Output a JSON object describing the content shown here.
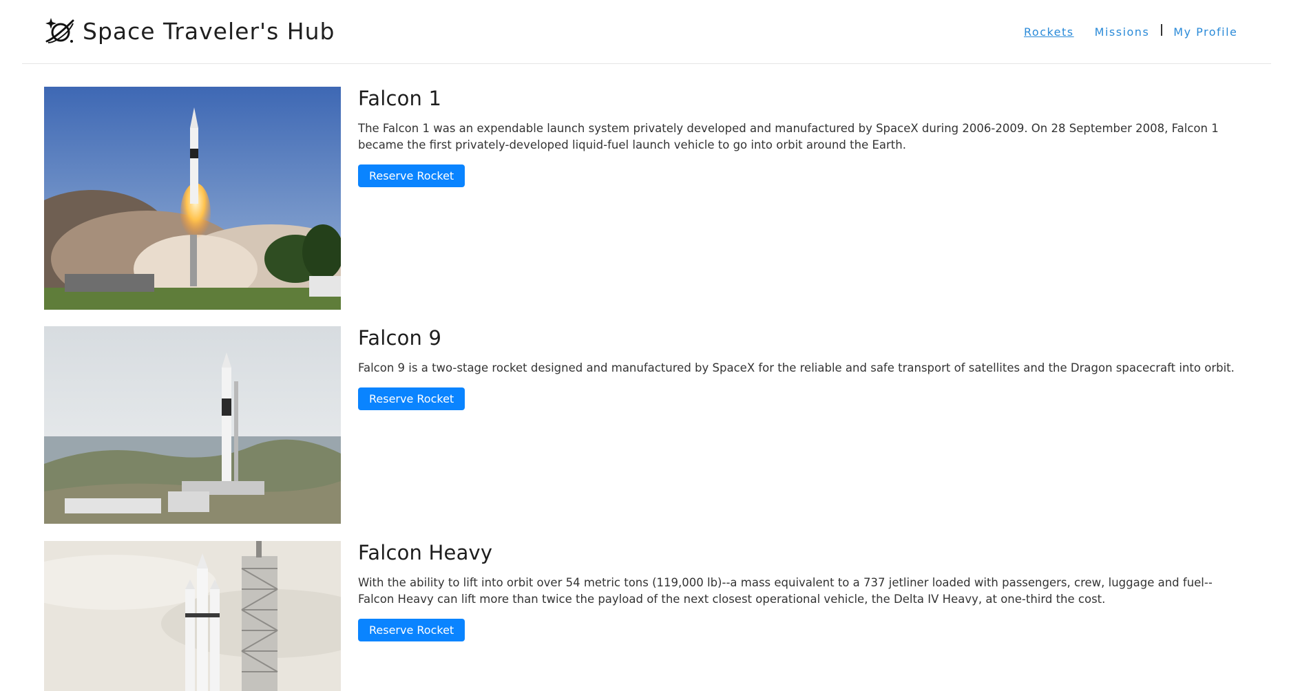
{
  "header": {
    "brand": "Space Traveler's Hub",
    "logo_icon": "planet-rocket-icon",
    "nav": [
      {
        "label": "Rockets",
        "active": true
      },
      {
        "label": "Missions",
        "active": false
      },
      {
        "label": "My Profile",
        "active": false
      }
    ]
  },
  "rockets": [
    {
      "name": "Falcon 1",
      "description": "The Falcon 1 was an expendable launch system privately developed and manufactured by SpaceX during 2006-2009. On 28 September 2008, Falcon 1 became the first privately-developed liquid-fuel launch vehicle to go into orbit around the Earth.",
      "button": "Reserve Rocket",
      "image": "rocket-launch-photo"
    },
    {
      "name": "Falcon 9",
      "description": "Falcon 9 is a two-stage rocket designed and manufactured by SpaceX for the reliable and safe transport of satellites and the Dragon spacecraft into orbit.",
      "button": "Reserve Rocket",
      "image": "rocket-on-pad-photo"
    },
    {
      "name": "Falcon Heavy",
      "description": "With the ability to lift into orbit over 54 metric tons (119,000 lb)--a mass equivalent to a 737 jetliner loaded with passengers, crew, luggage and fuel--Falcon Heavy can lift more than twice the payload of the next closest operational vehicle, the Delta IV Heavy, at one-third the cost.",
      "button": "Reserve Rocket",
      "image": "heavy-rocket-tower-photo"
    }
  ],
  "colors": {
    "accent": "#0a84ff",
    "nav_link": "#2a8ad8"
  }
}
